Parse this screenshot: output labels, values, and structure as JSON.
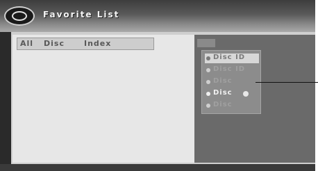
{
  "title": "Favorite List",
  "list": {
    "headers": [
      "All",
      "Disc",
      "Index"
    ],
    "rows": []
  },
  "menu": {
    "items": [
      {
        "label": "Disc ID",
        "state": "selected"
      },
      {
        "label": "Disc ID",
        "state": "dim"
      },
      {
        "label": "Disc",
        "state": "dim"
      },
      {
        "label": "Disc",
        "state": "active"
      },
      {
        "label": "Disc",
        "state": "dim"
      }
    ]
  }
}
